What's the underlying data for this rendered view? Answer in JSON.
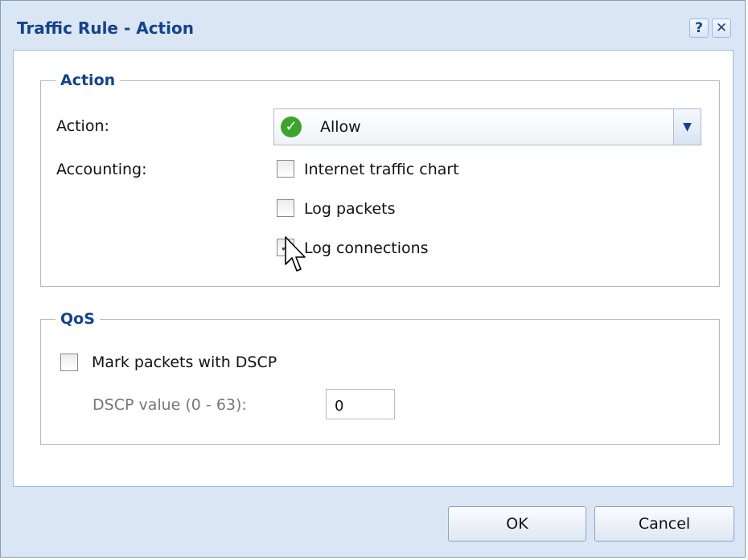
{
  "dialog": {
    "title": "Traffic Rule - Action",
    "help_label": "?",
    "close_label": "✕"
  },
  "action_group": {
    "legend": "Action",
    "action_label": "Action:",
    "action_value": "Allow",
    "action_icon": "check-circle-icon",
    "accounting_label": "Accounting:",
    "checkboxes": [
      {
        "label": "Internet traffic chart",
        "checked": false
      },
      {
        "label": "Log packets",
        "checked": false
      },
      {
        "label": "Log connections",
        "checked": true
      }
    ]
  },
  "qos_group": {
    "legend": "QoS",
    "mark_dscp_label": "Mark packets with DSCP",
    "mark_dscp_checked": false,
    "dscp_value_label": "DSCP value (0 - 63):",
    "dscp_value": "0"
  },
  "buttons": {
    "ok": "OK",
    "cancel": "Cancel"
  },
  "colors": {
    "title": "#15428b",
    "frame": "#dbe6f4",
    "allow_icon": "#3da32d"
  }
}
